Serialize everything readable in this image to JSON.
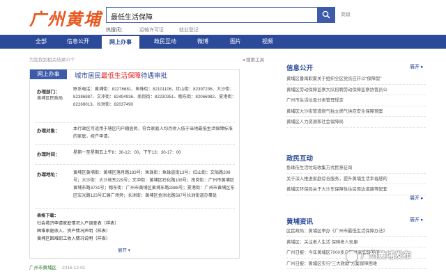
{
  "header": {
    "logo_text": "广州黄埔",
    "search_value": "最低生活保障",
    "advanced_label": "高级",
    "hot_label": "热搜词：",
    "hot_terms": [
      "运输许可证",
      "就业登记"
    ]
  },
  "nav": {
    "items": [
      "全部",
      "信息公开",
      "网上办事",
      "政民互动",
      "微博",
      "图片",
      "视频"
    ],
    "active": "网上办事"
  },
  "results": {
    "count_text": "为您找到相关结果37个",
    "search_tools": "搜索工具",
    "card": {
      "tag": "网上办事",
      "title_before": "城市居民",
      "title_highlight": "最低生活保障",
      "title_after": "待遇审批",
      "dept_label": "办理部门：",
      "dept_value": "黄埔区民政局",
      "contact_text": "联系电话：黄埔街：82276681、鱼珠街：82101106、红山街：82397236、大沙街：82386887、文冲街：82494936、南岗街：82230351、穗东街：82066982、夏港街：82269013、长洲街：82037490",
      "target_label": "办理对象：",
      "target_text": "本行政区可适用于辖区内户籍居民，符合家庭人均月收入低于当地最低生活保障标准的家庭，按户申请。",
      "time_label": "办理时间：",
      "time_text": "星期一至星期五上午8：30-12：00，下午13：30-17：00",
      "address_label": "办理地址：",
      "address_text": "黄埔区黄埔街：黄埔区落月路183号；鱼珠街：鱼珠直街13号；红山街：文船路208号；大沙街：大沙地东229号；文冲街：黄埔区石化路108号；南岗街：广州市黄埔区黄埔东路3731号；穗东街：广州市黄埔区黄埔东路2888号；夏港街：广州市黄埔区东区宏光路123号汇展广场旁；长洲街：黄埔区金洲北路567号长洲街道办事处",
      "forms_label": "表格下载：",
      "forms": [
        "社会救济申请家庭情况入户调查表（样表）",
        "困难家庭收入、资产情况声明（样表）",
        "黄埔区困难职工收入情况说明（样表）"
      ],
      "expand_label": "展开"
    },
    "source": "广州市黄埔区",
    "date": "-2016-12-01"
  },
  "sidebar": {
    "sections": [
      {
        "title": "信息公开",
        "more": "展开",
        "items": [
          "黄埔区番禺职聚关于组织全区党员应开以“保障型”",
          "黄埔区劳动保障监察大队招聘劳动保障监察协管员公",
          "广州市生活垃圾分类管理规定",
          "黄埔区大沙街管道燃气独立燃气供应安全保障预案",
          "黄埔区人力资源和社会保障局"
        ]
      },
      {
        "title": "政民互动",
        "more": "展开",
        "items": [
          "鱼珠街生活垃圾收集方式民意征询",
          "关于深入推进家庭综合服务，提升黄埔生活幸福感的",
          "黄埔区环保局关于大沙东保障性住房周边道路等配套"
        ]
      },
      {
        "title": "黄埔资讯",
        "more": "展开",
        "items": [
          "区民政局：黄埔区举办《广州市最低生活保障办法》",
          "黄埔区：关注老人生活 保障老人安康",
          "广州日报：今年黄埔区7000多户困难家庭获慰问",
          "广州日报：黄埔区实行“三大救助”方案保障困难"
        ]
      }
    ]
  },
  "watermark": "广州黄埔发布",
  "colors": {
    "primary": "#2c4a9a",
    "logo": "#e8581f",
    "highlight": "#e02020",
    "source": "#2a7a2a"
  }
}
